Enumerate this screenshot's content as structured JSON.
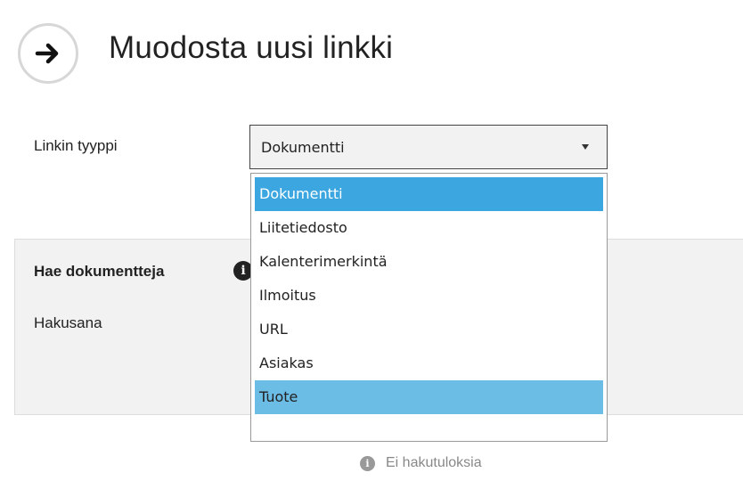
{
  "header": {
    "icon": "arrow-right-icon",
    "title": "Muodosta uusi linkki"
  },
  "link_type": {
    "label": "Linkin tyyppi",
    "selected_value": "Dokumentti",
    "options": [
      "Dokumentti",
      "Liitetiedosto",
      "Kalenterimerkintä",
      "Ilmoitus",
      "URL",
      "Asiakas",
      "Tuote"
    ],
    "highlighted_option": "Tuote"
  },
  "search_panel": {
    "title": "Hae dokumentteja",
    "info_icon": "info-icon",
    "keyword_label": "Hakusana"
  },
  "results": {
    "icon": "info-icon",
    "no_results_text": "Ei hakutuloksia"
  },
  "colors": {
    "selected_option": "#3ba6df",
    "hovered_option": "#6cbde6",
    "panel_background": "#f2f2f2"
  }
}
